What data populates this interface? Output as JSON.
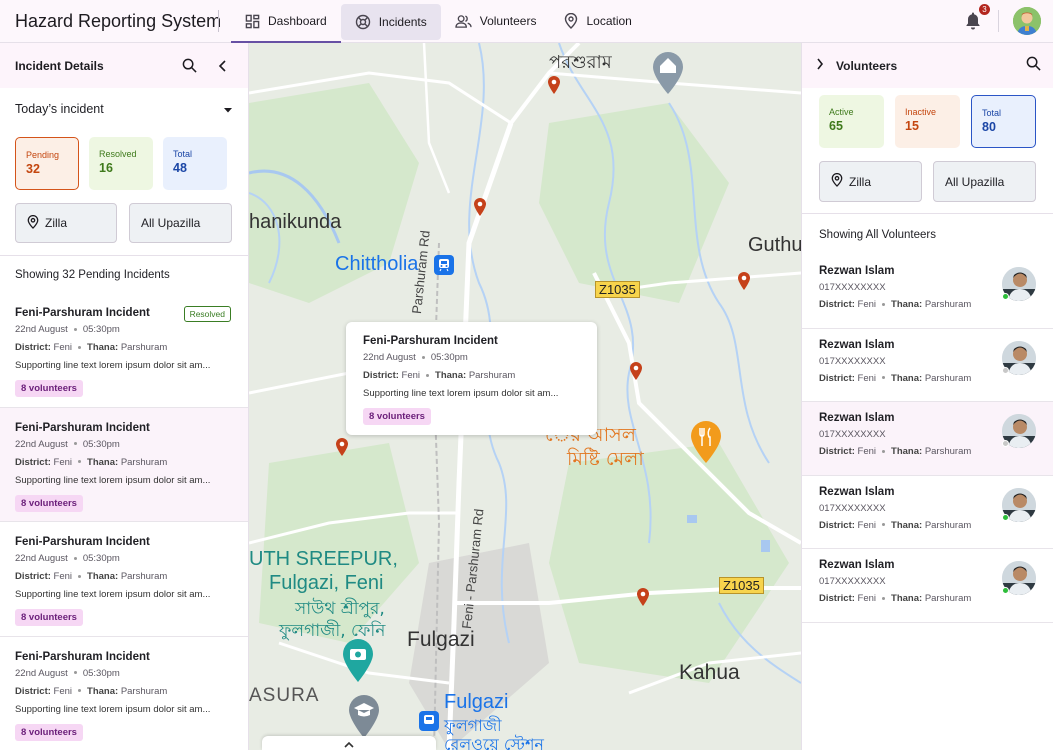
{
  "app": {
    "title": "Hazard Reporting System",
    "notifications": "3"
  },
  "nav": [
    {
      "label": "Dashboard",
      "icon": "dashboard-icon"
    },
    {
      "label": "Incidents",
      "icon": "incidents-icon"
    },
    {
      "label": "Volunteers",
      "icon": "volunteers-icon"
    },
    {
      "label": "Location",
      "icon": "location-icon"
    }
  ],
  "left": {
    "title": "Incident Details",
    "dropdown": "Today’s incident",
    "stats": [
      {
        "label": "Pending",
        "value": "32"
      },
      {
        "label": "Resolved",
        "value": "16"
      },
      {
        "label": "Total",
        "value": "48"
      }
    ],
    "filters": {
      "zilla": "Zilla",
      "upazilla": "All Upazilla"
    },
    "showing": "Showing 32 Pending Incidents",
    "incidents": [
      {
        "title": "Feni-Parshuram Incident",
        "date": "22nd August",
        "time": "05:30pm",
        "district_label": "District:",
        "district": "Feni",
        "thana_label": "Thana:",
        "thana": "Parshuram",
        "line": "Supporting line text lorem ipsum dolor sit am...",
        "chip": "8 volunteers",
        "status": "Resolved"
      },
      {
        "title": "Feni-Parshuram Incident",
        "date": "22nd August",
        "time": "05:30pm",
        "district_label": "District:",
        "district": "Feni",
        "thana_label": "Thana:",
        "thana": "Parshuram",
        "line": "Supporting line text lorem ipsum dolor sit am...",
        "chip": "8 volunteers"
      },
      {
        "title": "Feni-Parshuram Incident",
        "date": "22nd August",
        "time": "05:30pm",
        "district_label": "District:",
        "district": "Feni",
        "thana_label": "Thana:",
        "thana": "Parshuram",
        "line": "Supporting line text lorem ipsum dolor sit am...",
        "chip": "8 volunteers"
      },
      {
        "title": "Feni-Parshuram Incident",
        "date": "22nd August",
        "time": "05:30pm",
        "district_label": "District:",
        "district": "Feni",
        "thana_label": "Thana:",
        "thana": "Parshuram",
        "line": "Supporting line text lorem ipsum dolor sit am...",
        "chip": "8 volunteers"
      }
    ]
  },
  "popup": {
    "title": "Feni-Parshuram Incident",
    "date": "22nd August",
    "time": "05:30pm",
    "district_label": "District:",
    "district": "Feni",
    "thana_label": "Thana:",
    "thana": "Parshuram",
    "line": "Supporting line text lorem ipsum dolor sit am...",
    "chip": "8 volunteers"
  },
  "map": {
    "labels": {
      "parshuram_bn": "পরশুরাম",
      "hanikunda": "hanikunda",
      "chittholia": "Chittholia",
      "guthu": "Guthu",
      "road1": "Parshuram Rd",
      "road2": "Feni - Parshuram Rd",
      "z1035a": "Z1035",
      "z1035b": "Z1035",
      "sweet_bn1": "ের আসল",
      "sweet_bn2": "মিষ্টি মেলা",
      "sreepur": "UTH SREEPUR,",
      "fulgazi_feni": "Fulgazi, Feni",
      "sreepur_bn": "সাউথ শ্রীপুর,",
      "fulgazi_feni_bn": "ফুলগাজী, ফেনি",
      "fulgazi": "Fulgazi",
      "kahua": "Kahua",
      "asura": "ASURA",
      "fulgazi_station": "Fulgazi",
      "fulgazi_station_bn1": "ফুলগাজী",
      "fulgazi_station_bn2": "রেলওয়ে স্টেশন"
    },
    "colors": {
      "pin": "#c5411a",
      "water": "#a8c8f0",
      "road": "#ffffff",
      "green": "#cfe5c4"
    }
  },
  "right": {
    "title": "Volunteers",
    "stats": [
      {
        "label": "Active",
        "value": "65"
      },
      {
        "label": "Inactive",
        "value": "15"
      },
      {
        "label": "Total",
        "value": "80"
      }
    ],
    "filters": {
      "zilla": "Zilla",
      "upazilla": "All Upazilla"
    },
    "showing": "Showing All Volunteers",
    "volunteers": [
      {
        "name": "Rezwan Islam",
        "phone": "017XXXXXXXX",
        "district_label": "District:",
        "district": "Feni",
        "thana_label": "Thana:",
        "thana": "Parshuram",
        "status_color": "#2dbd3a"
      },
      {
        "name": "Rezwan Islam",
        "phone": "017XXXXXXXX",
        "district_label": "District:",
        "district": "Feni",
        "thana_label": "Thana:",
        "thana": "Parshuram",
        "status_color": "#c8c8c8"
      },
      {
        "name": "Rezwan Islam",
        "phone": "017XXXXXXXX",
        "district_label": "District:",
        "district": "Feni",
        "thana_label": "Thana:",
        "thana": "Parshuram",
        "status_color": "#c8c8c8"
      },
      {
        "name": "Rezwan Islam",
        "phone": "017XXXXXXXX",
        "district_label": "District:",
        "district": "Feni",
        "thana_label": "Thana:",
        "thana": "Parshuram",
        "status_color": "#2dbd3a"
      },
      {
        "name": "Rezwan Islam",
        "phone": "017XXXXXXXX",
        "district_label": "District:",
        "district": "Feni",
        "thana_label": "Thana:",
        "thana": "Parshuram",
        "status_color": "#2dbd3a"
      }
    ]
  }
}
